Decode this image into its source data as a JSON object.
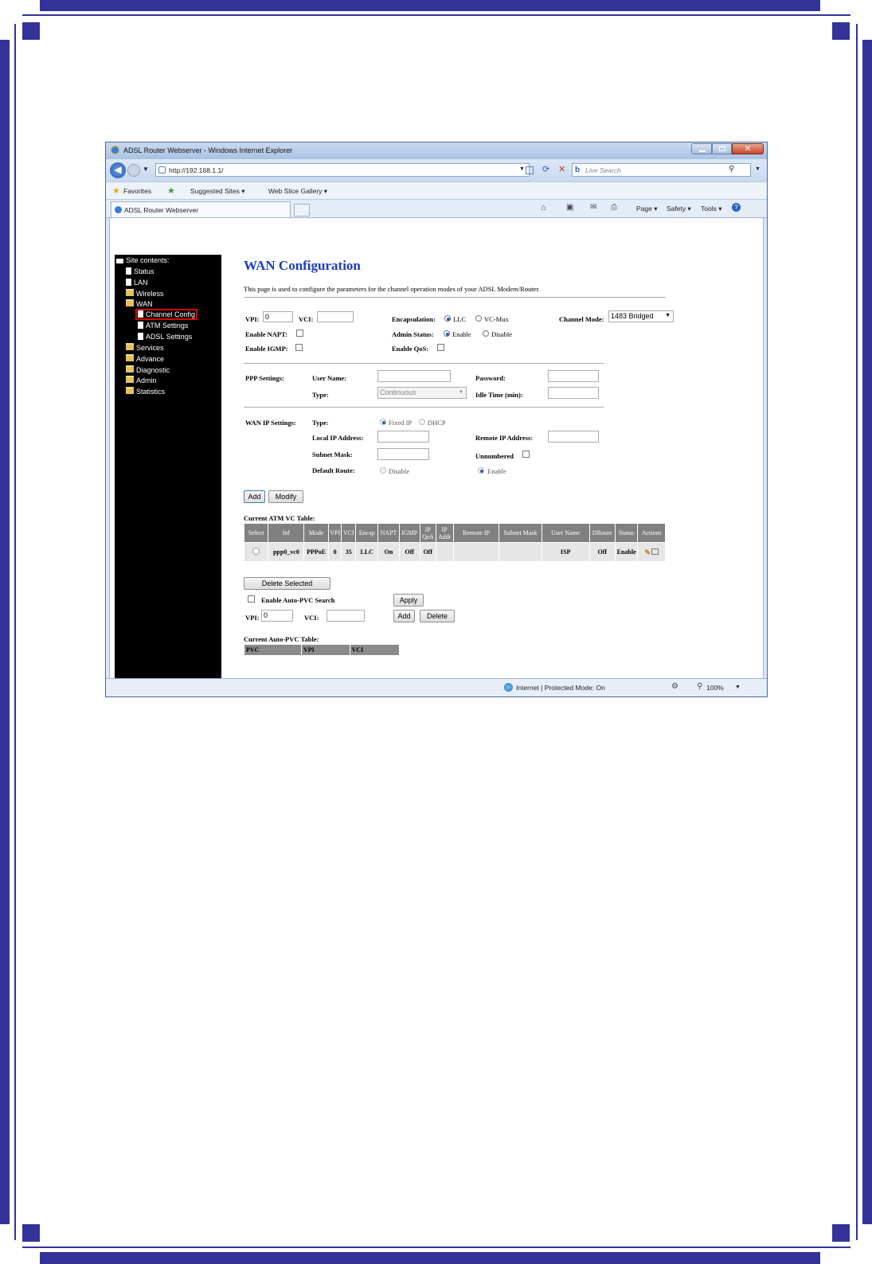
{
  "colors": {
    "frame": "#333399",
    "title_blue": "#1a3cc9",
    "highlight_red": "#dd0000"
  },
  "browser": {
    "window_title": "ADSL Router Webserver - Windows Internet Explorer",
    "url": "http://192.168.1.1/",
    "search_placeholder": "Live Search",
    "favorites": {
      "label": "Favorites",
      "suggested": "Suggested Sites ▾",
      "webslice": "Web Slice Gallery ▾"
    },
    "tab_title": "ADSL Router Webserver",
    "commands": {
      "page": "Page ▾",
      "safety": "Safety ▾",
      "tools": "Tools ▾"
    },
    "status": {
      "zone": "Internet | Protected Mode: On",
      "zoom": "100%"
    }
  },
  "sidebar": {
    "header": "Site contents:",
    "items": [
      {
        "label": "Status",
        "icon": "document-icon"
      },
      {
        "label": "LAN",
        "icon": "document-icon"
      },
      {
        "label": "Wireless",
        "icon": "folder-icon"
      },
      {
        "label": "WAN",
        "icon": "open-folder-icon"
      },
      {
        "label": "Channel Config",
        "icon": "document-icon",
        "selected": true
      },
      {
        "label": "ATM Settings",
        "icon": "document-icon"
      },
      {
        "label": "ADSL Settings",
        "icon": "document-icon"
      },
      {
        "label": "Services",
        "icon": "folder-icon"
      },
      {
        "label": "Advance",
        "icon": "folder-icon"
      },
      {
        "label": "Diagnostic",
        "icon": "folder-icon"
      },
      {
        "label": "Admin",
        "icon": "folder-icon"
      },
      {
        "label": "Statistics",
        "icon": "folder-icon"
      }
    ]
  },
  "page": {
    "title": "WAN Configuration",
    "description": "This page is used to configure the parameters for the channel operation modes of your ADSL Modem/Router.",
    "vpi_label": "VPI:",
    "vpi_value": "0",
    "vci_label": "VCI:",
    "vci_value": "",
    "encapsulation_label": "Encapsulation:",
    "enc_llc": "LLC",
    "enc_vcmux": "VC-Mux",
    "channel_mode_label": "Channel Mode:",
    "channel_mode_value": "1483 Bridged",
    "enable_napt_label": "Enable NAPT:",
    "admin_status_label": "Admin Status:",
    "admin_enable": "Enable",
    "admin_disable": "Disable",
    "enable_igmp_label": "Enable IGMP:",
    "enable_qos_label": "Enable QoS:",
    "ppp": {
      "section_label": "PPP Settings:",
      "username_label": "User Name:",
      "password_label": "Password:",
      "type_label": "Type:",
      "type_value": "Continuous",
      "idle_label": "Idle Time (min):"
    },
    "wanip": {
      "section_label": "WAN IP Settings:",
      "type_label": "Type:",
      "fixed_ip": "Fixed IP",
      "dhcp": "DHCP",
      "local_ip_label": "Local IP Address:",
      "remote_ip_label": "Remote IP Address:",
      "subnet_label": "Subnet Mask:",
      "unnumbered_label": "Unnumbered",
      "default_route_label": "Default Route:",
      "dr_disable": "Disable",
      "dr_enable": "Enable"
    },
    "add_button": "Add",
    "modify_button": "Modify",
    "atm_table_title": "Current ATM VC Table:",
    "atm_headers": [
      "Select",
      "Inf",
      "Mode",
      "VPI",
      "VCI",
      "Encap",
      "NAPT",
      "IGMP",
      "IP QoS",
      "IP Addr",
      "Remote IP",
      "Subnet Mask",
      "User Name",
      "DRoute",
      "Status",
      "Actions"
    ],
    "atm_row": [
      "",
      "ppp0_vc0",
      "PPPoE",
      "0",
      "35",
      "LLC",
      "On",
      "Off",
      "Off",
      "",
      "",
      "",
      "ISP",
      "Off",
      "Enable",
      ""
    ],
    "delete_selected_button": "Delete Selected",
    "auto_pvc_label": "Enable Auto-PVC Search",
    "apply_button": "Apply",
    "pvc_vpi_label": "VPI:",
    "pvc_vpi_value": "0",
    "pvc_vci_label": "VCI:",
    "pvc_vci_value": "",
    "pvc_add_button": "Add",
    "pvc_delete_button": "Delete",
    "pvc_table_title": "Current Auto-PVC Table:",
    "pvc_headers": [
      "PVC",
      "VPI",
      "VCI"
    ]
  }
}
